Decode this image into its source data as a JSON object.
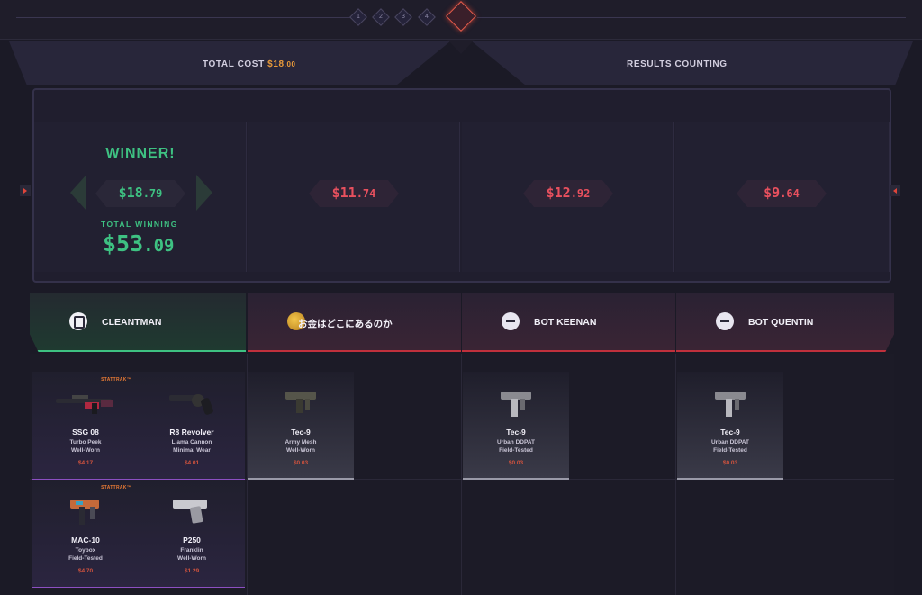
{
  "rounds": [
    "1",
    "2",
    "3",
    "4"
  ],
  "header": {
    "total_cost_label": "TOTAL COST",
    "total_cost_whole": "$18",
    "total_cost_cents": ".00",
    "results_label": "RESULTS COUNTING"
  },
  "summary": {
    "winner_label": "WINNER!",
    "total_winning_label": "TOTAL WINNING",
    "total_winning_whole": "$53",
    "total_winning_cents": ".09",
    "players": [
      {
        "price_whole": "$18",
        "price_cents": ".79",
        "result": "winner"
      },
      {
        "price_whole": "$11",
        "price_cents": ".74",
        "result": "loser"
      },
      {
        "price_whole": "$12",
        "price_cents": ".92",
        "result": "loser"
      },
      {
        "price_whole": "$9",
        "price_cents": ".64",
        "result": "loser"
      }
    ]
  },
  "players": [
    {
      "name": "CLEANTMAN",
      "avatar": "logo-icon"
    },
    {
      "name": "お金はどこにあるのか",
      "avatar": "anime-avatar-icon"
    },
    {
      "name": "BOT KEENAN",
      "avatar": "bot-icon"
    },
    {
      "name": "BOT QUENTIN",
      "avatar": "bot-icon"
    }
  ],
  "items": {
    "p0": [
      {
        "name": "SSG 08",
        "skin": "Turbo Peek",
        "wear": "Well-Worn",
        "price": "$4.17",
        "stattrak": "STATTRAK™"
      },
      {
        "name": "R8 Revolver",
        "skin": "Llama Cannon",
        "wear": "Minimal Wear",
        "price": "$4.01"
      },
      {
        "name": "MAC-10",
        "skin": "Toybox",
        "wear": "Field-Tested",
        "price": "$4.70",
        "stattrak": "STATTRAK™"
      },
      {
        "name": "P250",
        "skin": "Franklin",
        "wear": "Well-Worn",
        "price": "$1.29"
      }
    ],
    "p1": [
      {
        "name": "Tec-9",
        "skin": "Army Mesh",
        "wear": "Well-Worn",
        "price": "$0.03"
      }
    ],
    "p2": [
      {
        "name": "Tec-9",
        "skin": "Urban DDPAT",
        "wear": "Field-Tested",
        "price": "$0.03"
      }
    ],
    "p3": [
      {
        "name": "Tec-9",
        "skin": "Urban DDPAT",
        "wear": "Field-Tested",
        "price": "$0.03"
      }
    ]
  },
  "colors": {
    "winner": "#3ec182",
    "loser": "#e8505e",
    "accent": "#e99a3a"
  }
}
